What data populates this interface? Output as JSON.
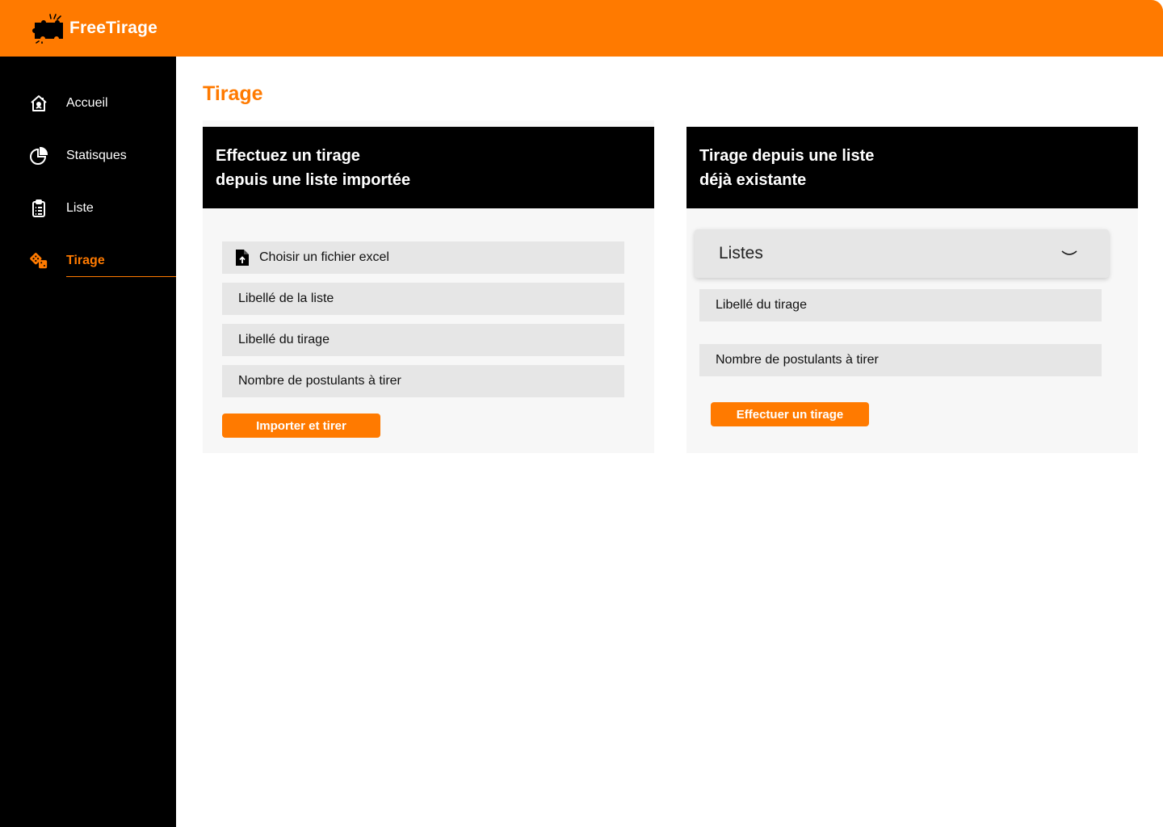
{
  "header": {
    "brand": "FreeTirage"
  },
  "sidebar": {
    "items": [
      {
        "label": "Accueil",
        "icon": "home-icon"
      },
      {
        "label": "Statisques",
        "icon": "pie-chart-icon"
      },
      {
        "label": "Liste",
        "icon": "clipboard-list-icon"
      },
      {
        "label": "Tirage",
        "icon": "dice-icon",
        "active": true
      }
    ]
  },
  "page": {
    "title": "Tirage"
  },
  "import_card": {
    "title_line1": "Effectuez un tirage",
    "title_line2": "depuis une liste importée",
    "file_label": "Choisir un fichier excel",
    "list_label_placeholder": "Libellé de la liste",
    "draw_label_placeholder": "Libellé du tirage",
    "count_placeholder": "Nombre de postulants à tirer",
    "button": "Importer et tirer"
  },
  "existing_card": {
    "title_line1": "Tirage depuis une liste",
    "title_line2": "déjà existante",
    "select_value": "Listes",
    "draw_label_placeholder": "Libellé du tirage",
    "count_placeholder": "Nombre de postulants à tirer",
    "button": "Effectuer un tirage"
  },
  "colors": {
    "accent": "#ff7a00",
    "sidebar": "#000000",
    "field": "#e6e6e6",
    "card": "#f7f7f7"
  }
}
